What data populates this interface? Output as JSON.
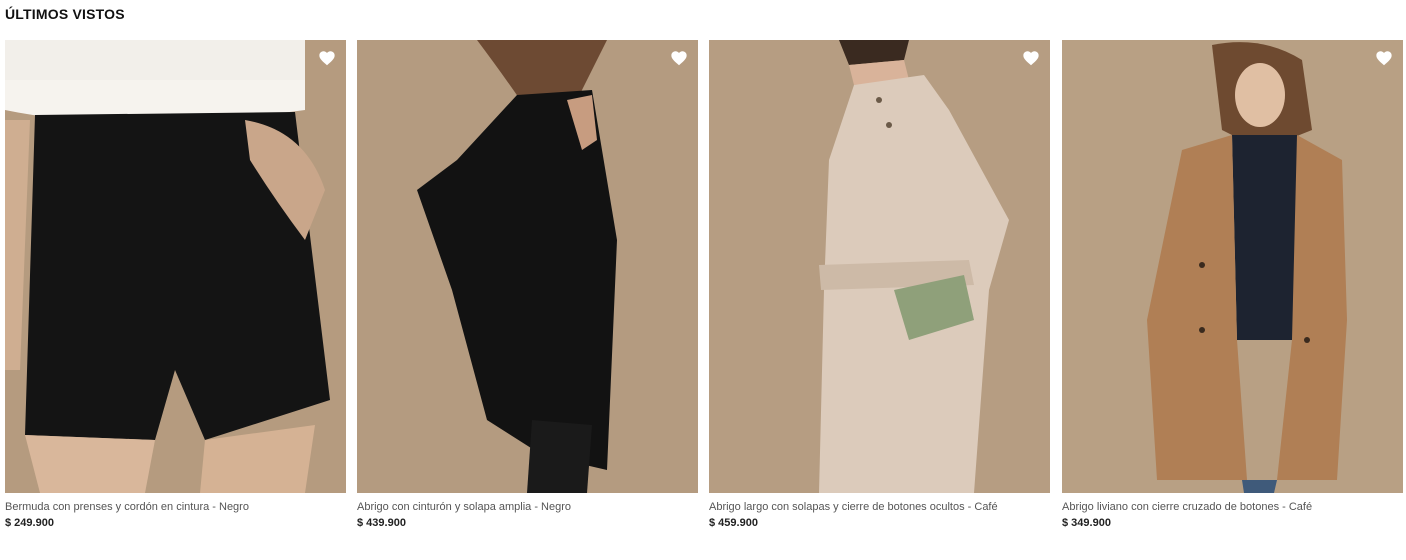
{
  "section": {
    "title": "ÚLTIMOS VISTOS"
  },
  "products": [
    {
      "name": "Bermuda con prenses y cordón en cintura - Negro",
      "price": "$ 249.900",
      "garment_color": "#141414"
    },
    {
      "name": "Abrigo con cinturón y solapa amplia - Negro",
      "price": "$ 439.900",
      "garment_color": "#121212"
    },
    {
      "name": "Abrigo largo con solapas y cierre de botones ocultos - Café",
      "price": "$ 459.900",
      "garment_color": "#dccbbb"
    },
    {
      "name": "Abrigo liviano con cierre cruzado de botones - Café",
      "price": "$ 349.900",
      "garment_color": "#b07f55"
    }
  ],
  "icons": {
    "favorite": "heart-icon"
  },
  "colors": {
    "photo_background": "#b39a7e",
    "heart": "#ffffff"
  }
}
